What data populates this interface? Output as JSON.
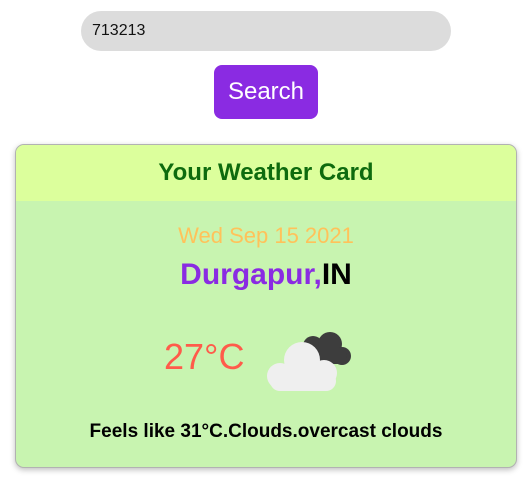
{
  "search": {
    "value": "713213",
    "button_label": "Search"
  },
  "card": {
    "title": "Your Weather Card",
    "date": "Wed Sep 15 2021",
    "city": "Durgapur,",
    "country": "IN",
    "temperature": "27°C",
    "weather_icon": "broken-clouds-icon",
    "description": "Feels like 31°C.Clouds.overcast clouds"
  },
  "colors": {
    "button": "#8a2be2",
    "card_background": "#c8f4b0",
    "card_header": "#dcff9c",
    "title": "#0e6b0e",
    "date": "#ffc25a",
    "city": "#8a2be2",
    "temperature": "#ff5b4a"
  }
}
